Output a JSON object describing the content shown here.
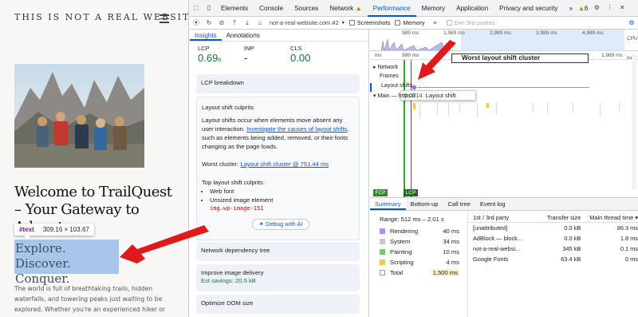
{
  "site": {
    "title": "THIS IS NOT A REAL WEBSITE",
    "headline": "Welcome to TrailQuest – Your Gateway to Adventure",
    "tooltip_tag": "#text",
    "tooltip_size": "309.16 × 103.67",
    "tagline": "Explore. Discover. Conquer.",
    "body": "The world is full of breathtaking trails, hidden waterfalls, and towering peaks just waiting to be explored. Whether you're an experienced hiker or taking your first steps into nature's"
  },
  "devtools": {
    "tabs": [
      "Elements",
      "Console",
      "Sources",
      "Network",
      "Performance",
      "Memory",
      "Application",
      "Privacy and security",
      "»"
    ],
    "active_tab": "Performance",
    "warning_count": "6",
    "url_select": "not-a-real-website.com #2",
    "checkboxes": {
      "screenshots": "Screenshots",
      "memory": "Memory",
      "dim": "Dim 3rd parties"
    }
  },
  "insights": {
    "tabs": [
      "Insights",
      "Annotations"
    ],
    "metrics": [
      {
        "label": "LCP",
        "value": "0.69",
        "unit": "s"
      },
      {
        "label": "INP",
        "value": "-",
        "unit": ""
      },
      {
        "label": "CLS",
        "value": "0.00",
        "unit": ""
      }
    ],
    "lcp_breakdown": "LCP breakdown",
    "culprits": {
      "title": "Layout shift culprits",
      "desc_before": "Layout shifts occur when elements move absent any user interaction. ",
      "desc_link": "Investigate the causes of layout shifts",
      "desc_after": ", such as elements being added, removed, or their fonts changing as the page loads.",
      "worst_label": "Worst cluster: ",
      "worst_link": "Layout shift cluster @ 751.44 ms",
      "top_label": "Top layout shift culprits:",
      "items": [
        "Web font",
        "Unsized image element"
      ],
      "code": "img.wp-image-151",
      "debug": "Debug with AI"
    },
    "cards": [
      {
        "title": "Network dependency tree"
      },
      {
        "title": "Improve image delivery",
        "sub": "Est savings: 20.5 kB"
      },
      {
        "title": "Optimize DOM size"
      }
    ]
  },
  "timeline": {
    "overview_ticks": [
      "989 ms",
      "1,989 ms",
      "2,989 ms",
      "3,989 ms",
      "4,989 ms"
    ],
    "side_labels": [
      "CPU",
      "NET"
    ],
    "ruler_left": "ms",
    "ruler_mid": "989 ms",
    "ruler_right": "1,989 ms",
    "cluster_title": "Worst layout shift cluster",
    "lanes": [
      "Network",
      "Frames",
      "Layout shifts",
      "Main — https://"
    ],
    "tip_value": "0.0014",
    "tip_label": "Layout shift",
    "markers": [
      "FCP",
      "LCP"
    ]
  },
  "bottom": {
    "tabs": [
      "Summary",
      "Bottom-up",
      "Call tree",
      "Event log"
    ],
    "range": "Range: 512 ms – 2.01 s",
    "categories": [
      {
        "name": "Rendering",
        "value": "40 ms",
        "color": "#b48ef0"
      },
      {
        "name": "System",
        "value": "34 ms",
        "color": "#c8c8c8"
      },
      {
        "name": "Painting",
        "value": "10 ms",
        "color": "#7dc77d"
      },
      {
        "name": "Scripting",
        "value": "4 ms",
        "color": "#f2c94c"
      },
      {
        "name": "Total",
        "value": "1,500 ms",
        "color": "#ffffff"
      }
    ],
    "party_headers": [
      "1st / 3rd party",
      "Transfer size",
      "Main thread time ▾"
    ],
    "party_rows": [
      [
        "[unattributed]",
        "0.0 kB",
        "86.3 ms"
      ],
      [
        "AdBlock — block...",
        "0.0 kB",
        "1.8 ms"
      ],
      [
        "not-a-real-websi...",
        "345 kB",
        "0.1 ms"
      ],
      [
        "Google Fonts",
        "63.4 kB",
        "0 ms"
      ]
    ]
  }
}
